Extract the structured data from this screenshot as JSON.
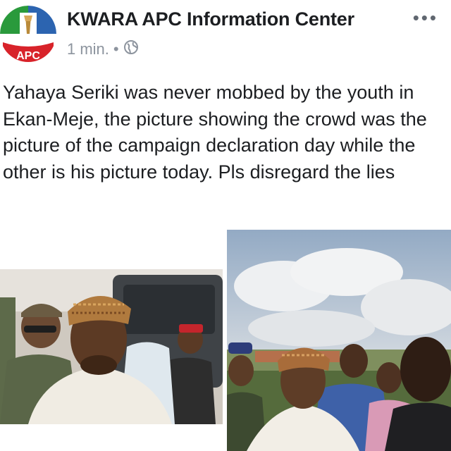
{
  "post": {
    "page_name": "KWARA APC Information Center",
    "timestamp": "1 min.",
    "separator": "•",
    "privacy_icon": "globe-icon",
    "more_icon": "more-options-icon",
    "more_glyph": "•••",
    "avatar_logo_text": "APC",
    "text": "Yahaya Seriki was never mobbed by the youth in Ekan-Meje, the picture showing the crowd was the picture of the campaign declaration day while the other is his picture today. Pls disregard the lies"
  },
  "colors": {
    "logo_green": "#2a9a3c",
    "logo_red": "#d8232a",
    "logo_blue": "#2c64b0",
    "text": "#1c1e21",
    "meta": "#8d949e"
  }
}
